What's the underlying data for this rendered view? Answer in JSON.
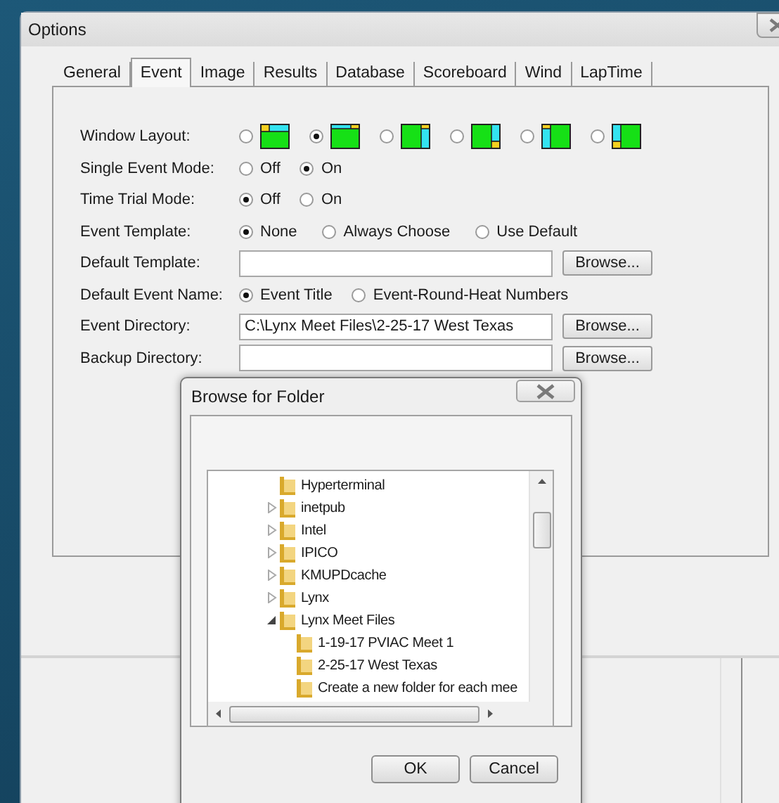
{
  "window": {
    "title": "Options"
  },
  "tabs": [
    {
      "label": "General",
      "selected": false
    },
    {
      "label": "Event",
      "selected": true
    },
    {
      "label": "Image",
      "selected": false
    },
    {
      "label": "Results",
      "selected": false
    },
    {
      "label": "Database",
      "selected": false
    },
    {
      "label": "Scoreboard",
      "selected": false
    },
    {
      "label": "Wind",
      "selected": false
    },
    {
      "label": "LapTime",
      "selected": false
    }
  ],
  "settings": [
    {
      "kind": "layout",
      "label": "Window Layout:",
      "options": [
        {
          "kind": "top-left",
          "selected": false
        },
        {
          "kind": "top-right",
          "selected": true
        },
        {
          "kind": "right-full",
          "selected": false
        },
        {
          "kind": "right-split",
          "selected": false
        },
        {
          "kind": "left-full",
          "selected": false
        },
        {
          "kind": "left-split",
          "selected": false
        }
      ]
    },
    {
      "kind": "radio",
      "label": "Single Event Mode:",
      "options": [
        {
          "label": "Off",
          "selected": false
        },
        {
          "label": "On",
          "selected": true
        }
      ]
    },
    {
      "kind": "radio",
      "label": "Time Trial Mode:",
      "options": [
        {
          "label": "Off",
          "selected": true
        },
        {
          "label": "On",
          "selected": false
        }
      ]
    },
    {
      "kind": "radio",
      "label": "Event Template:",
      "options": [
        {
          "label": "None",
          "selected": true
        },
        {
          "label": "Always Choose",
          "selected": false
        },
        {
          "label": "Use Default",
          "selected": false
        }
      ]
    },
    {
      "kind": "path",
      "label": "Default Template:",
      "button": "Browse..."
    },
    {
      "kind": "radio",
      "label": "Default Event Name:",
      "options": [
        {
          "label": "Event Title",
          "selected": true
        },
        {
          "label": "Event-Round-Heat Numbers",
          "selected": false
        }
      ]
    },
    {
      "kind": "path",
      "label": "Event Directory:",
      "value": "C:\\Lynx Meet Files\\2-25-17 West Texas",
      "button": "Browse..."
    },
    {
      "kind": "path",
      "label": "Backup Directory:",
      "button": "Browse..."
    }
  ],
  "dialog": {
    "title": "Browse for Folder",
    "tree": [
      {
        "label": "Hyperterminal",
        "kind": "plain"
      },
      {
        "label": "inetpub",
        "kind": "expandable",
        "expanded": false
      },
      {
        "label": "Intel",
        "kind": "expandable",
        "expanded": false
      },
      {
        "label": "IPICO",
        "kind": "expandable",
        "expanded": false
      },
      {
        "label": "KMUPDcache",
        "kind": "expandable",
        "expanded": false
      },
      {
        "label": "Lynx",
        "kind": "expandable",
        "expanded": false
      },
      {
        "label": "Lynx Meet Files",
        "kind": "expandable",
        "expanded": true,
        "children": [
          {
            "label": "1-19-17 PVIAC Meet 1",
            "kind": "plain"
          },
          {
            "label": "2-25-17 West Texas",
            "kind": "plain"
          },
          {
            "label": "Create a new folder for each mee",
            "kind": "plain"
          }
        ]
      }
    ],
    "buttons": [
      "OK",
      "Cancel"
    ]
  }
}
